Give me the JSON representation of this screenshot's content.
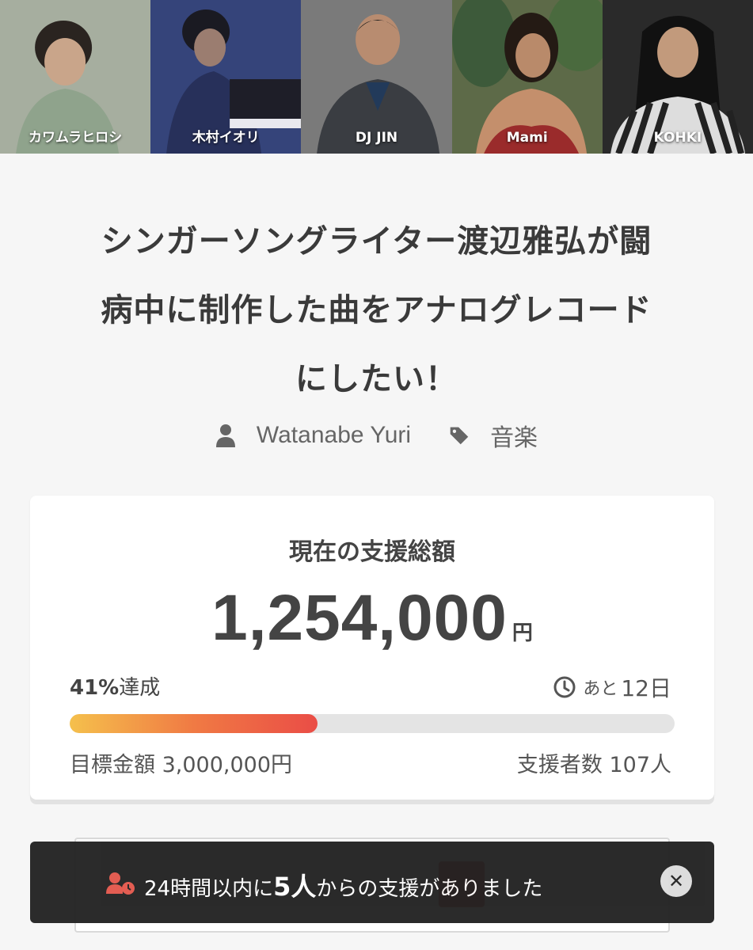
{
  "banner": {
    "artists": [
      {
        "name": "カワムラヒロシ",
        "bg": "#9aa596"
      },
      {
        "name": "木村イオリ",
        "bg": "#3c4a7c"
      },
      {
        "name": "DJ JIN",
        "bg": "#6b6b6b"
      },
      {
        "name": "Mami",
        "bg": "#6b5a44"
      },
      {
        "name": "KOHKI",
        "bg": "#2b2b2b"
      }
    ]
  },
  "project": {
    "title_line1": "シンガーソングライター渡辺雅弘が闘",
    "title_line2": "病中に制作した曲をアナログレコード",
    "title_line3": "にしたい！",
    "author": "Watanabe Yuri",
    "category": "音楽"
  },
  "funding": {
    "label": "現在の支援総額",
    "amount": "1,254,000",
    "currency": "円",
    "achieved_percent": "41%",
    "achieved_suffix": "達成",
    "progress": 0.41,
    "remaining_prefix": "あと",
    "remaining_days": "12日",
    "goal": "目標金額 3,000,000円",
    "supporters": "支援者数 107人"
  },
  "toast": {
    "prefix": "24時間以内に",
    "count": "5人",
    "suffix": "からの支援がありました",
    "close_icon": "close-icon"
  }
}
